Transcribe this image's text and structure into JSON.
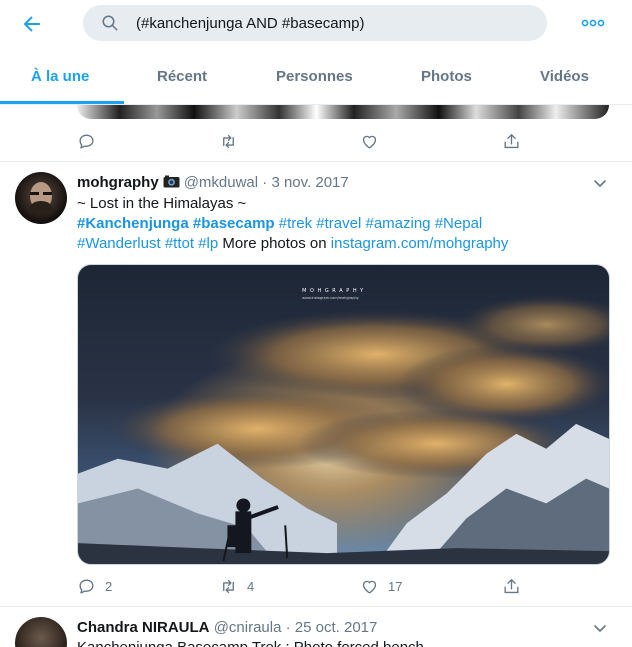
{
  "header": {
    "search_query": "(#kanchenjunga AND #basecamp)"
  },
  "tabs": [
    {
      "label": "À la une"
    },
    {
      "label": "Récent"
    },
    {
      "label": "Personnes"
    },
    {
      "label": "Photos"
    },
    {
      "label": "Vidéos"
    }
  ],
  "tweets": [
    {
      "name": "mohgraphy",
      "handle": "@mkduwal",
      "date": "3 nov. 2017",
      "text_line1": "~ Lost in the Himalayas ~",
      "tags_bold": [
        "#Kanchenjunga",
        "#basecamp"
      ],
      "tags": [
        "#trek",
        "#travel",
        "#amazing",
        "#Nepal",
        "#Wanderlust",
        "#ttot",
        "#lp"
      ],
      "more_text": "More photos on",
      "link": "instagram.com/mohgraphy",
      "image_watermark": "M O H G R A P H Y",
      "image_watermark_url": "www.instagram.com/mohgraphy",
      "replies": "2",
      "retweets": "4",
      "likes": "17"
    },
    {
      "name": "Chandra NIRAULA",
      "handle": "@cniraula",
      "date": "25 oct. 2017",
      "text_partial": "Kanchenjunga Basecamp Trek : Photo forced bench"
    }
  ],
  "colors": {
    "accent": "#1da1f2",
    "link": "#1b95e0",
    "muted": "#657786",
    "search_bg": "#e6ecf0"
  },
  "icons": {
    "back": "arrow-left-icon",
    "search": "search-icon",
    "more": "more-dots-icon",
    "reply": "reply-icon",
    "retweet": "retweet-icon",
    "like": "heart-icon",
    "share": "share-icon",
    "caret": "chevron-down-icon",
    "camera": "camera-emoji-icon"
  }
}
